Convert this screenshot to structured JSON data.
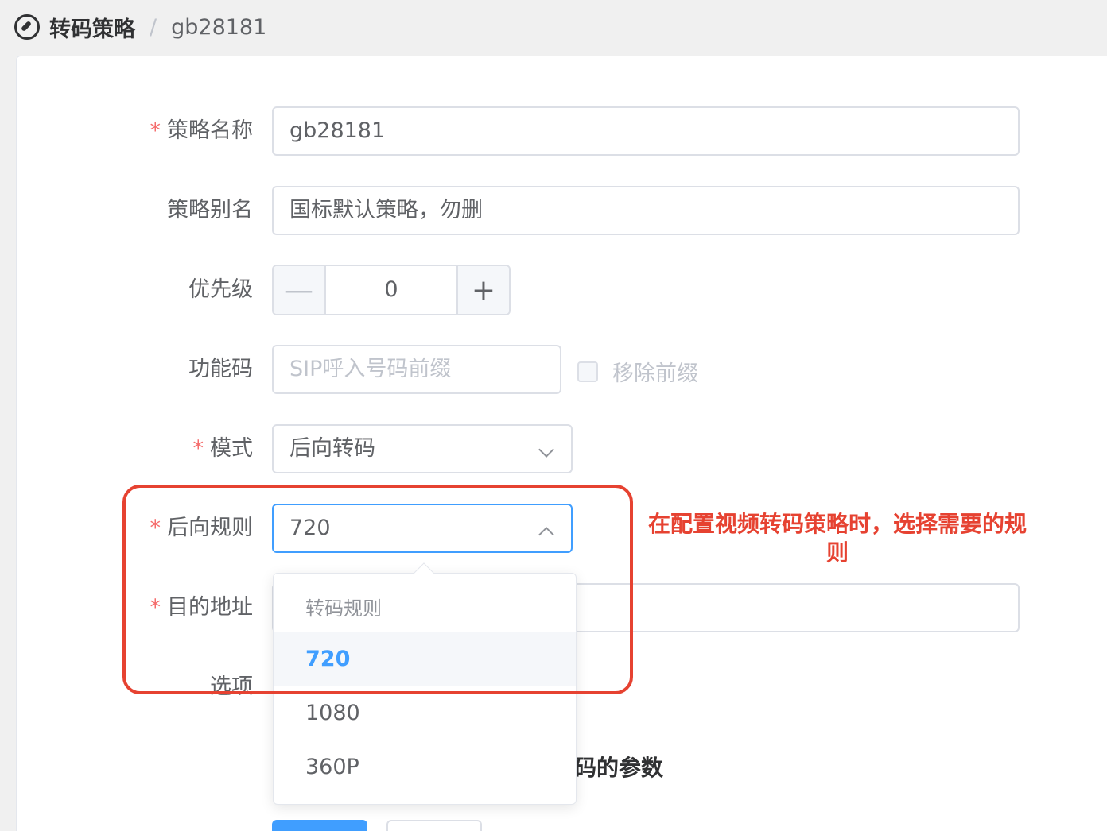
{
  "breadcrumb": {
    "section": "转码策略",
    "current": "gb28181"
  },
  "form": {
    "name_label": "策略名称",
    "name_value": "gb28181",
    "alias_label": "策略别名",
    "alias_value": "国标默认策略，勿删",
    "priority_label": "优先级",
    "priority_value": "0",
    "priority_minus": "—",
    "priority_plus": "+",
    "code_label": "功能码",
    "code_placeholder": "SIP呼入号码前缀",
    "remove_prefix_label": "移除前缀",
    "mode_label": "模式",
    "mode_value": "后向转码",
    "rule_label": "后向规则",
    "rule_value": "720",
    "target_label": "目的地址",
    "options_label": "选项",
    "partial_text": "码的参数",
    "required_mark": "*"
  },
  "dropdown": {
    "group_label": "转码规则",
    "options": [
      "720",
      "1080",
      "360P"
    ],
    "selected": "720"
  },
  "annotation": {
    "text": "在配置视频转码策略时，选择需要的规则"
  }
}
